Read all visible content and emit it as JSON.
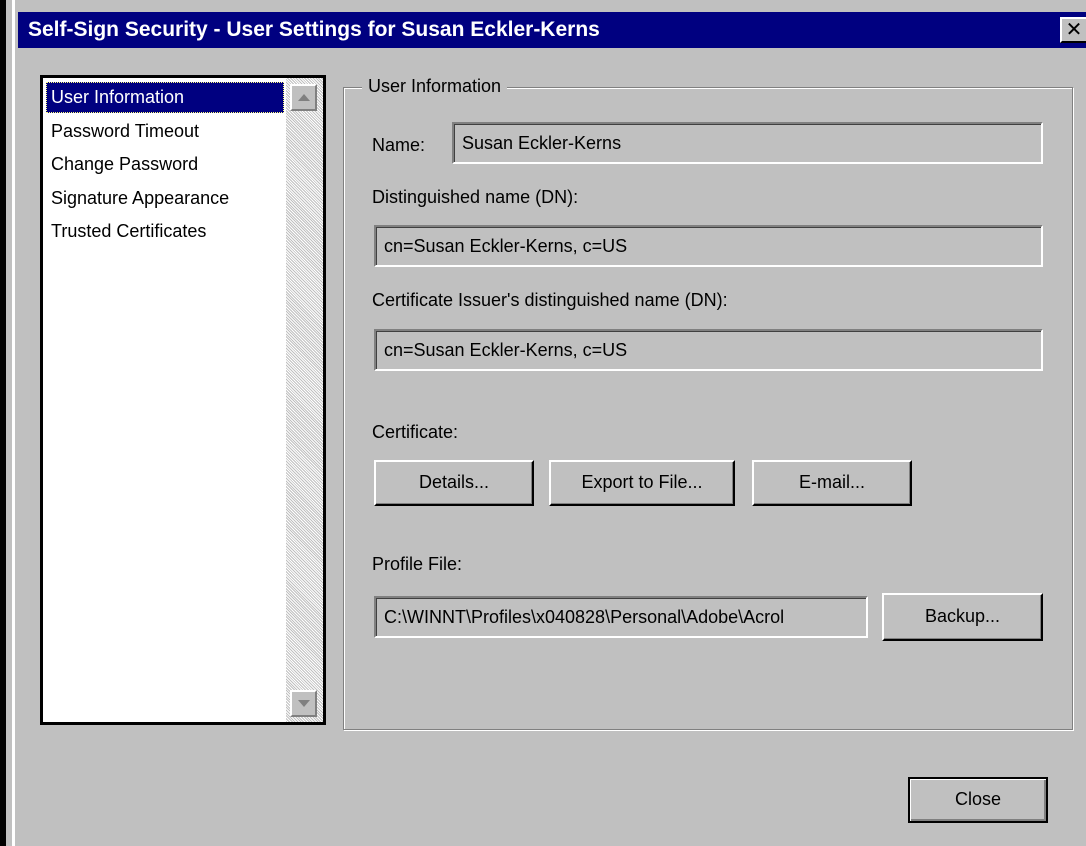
{
  "window": {
    "title": "Self-Sign Security - User Settings for Susan Eckler-Kerns",
    "close_glyph": "✕"
  },
  "sidebar": {
    "items": [
      {
        "label": "User Information",
        "selected": true
      },
      {
        "label": "Password Timeout",
        "selected": false
      },
      {
        "label": "Change Password",
        "selected": false
      },
      {
        "label": "Signature Appearance",
        "selected": false
      },
      {
        "label": "Trusted Certificates",
        "selected": false
      }
    ]
  },
  "user_info": {
    "group_title": "User Information",
    "name_label": "Name:",
    "name_value": "Susan Eckler-Kerns",
    "dn_label": "Distinguished name (DN):",
    "dn_value": "cn=Susan Eckler-Kerns, c=US",
    "issuer_dn_label": "Certificate Issuer's distinguished name (DN):",
    "issuer_dn_value": "cn=Susan Eckler-Kerns, c=US",
    "certificate_label": "Certificate:",
    "details_button": "Details...",
    "export_button": "Export to File...",
    "email_button": "E-mail...",
    "profile_label": "Profile File:",
    "profile_value": "C:\\WINNT\\Profiles\\x040828\\Personal\\Adobe\\Acrol",
    "backup_button": "Backup..."
  },
  "footer": {
    "close_button": "Close"
  },
  "colors": {
    "titlebar": "#000080",
    "face": "#c0c0c0",
    "selection": "#000080"
  }
}
